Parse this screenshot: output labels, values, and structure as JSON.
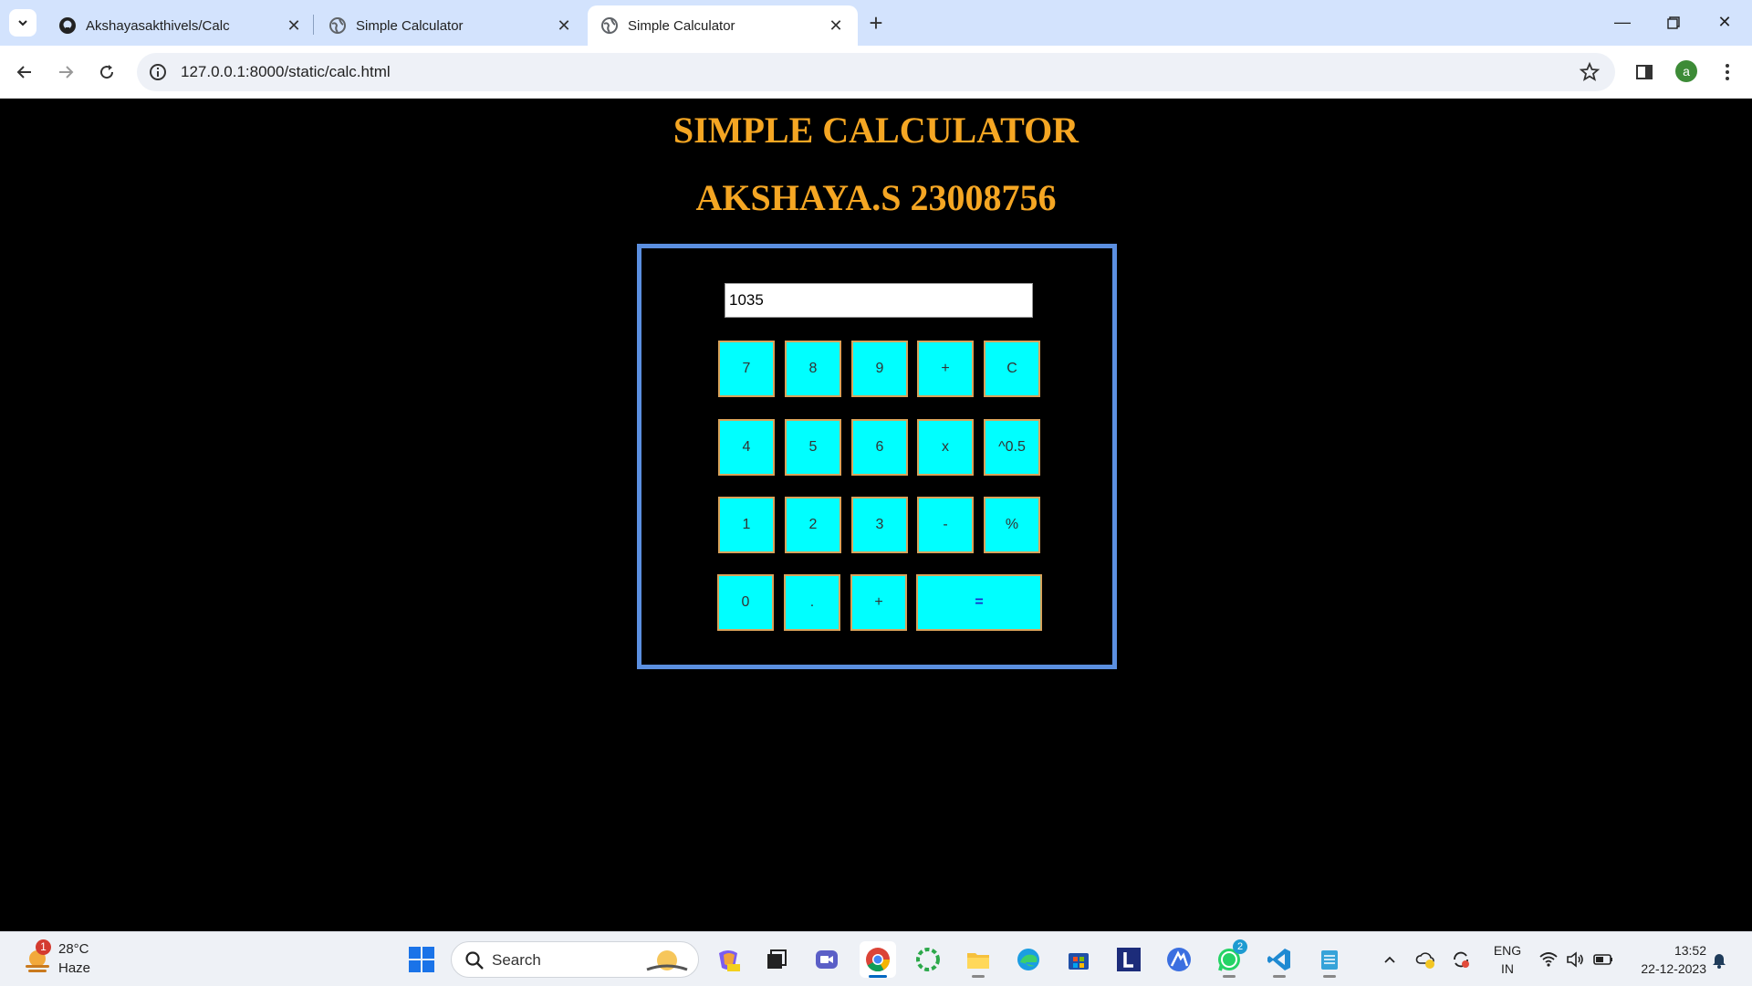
{
  "browser": {
    "tabs": [
      {
        "title": "Akshayasakthivels/Calc",
        "icon": "github-icon",
        "active": false
      },
      {
        "title": "Simple Calculator",
        "icon": "globe-icon",
        "active": false
      },
      {
        "title": "Simple Calculator",
        "icon": "globe-icon",
        "active": true
      }
    ],
    "new_tab_label": "+",
    "url": "127.0.0.1:8000/static/calc.html",
    "profile_initial": "a"
  },
  "page": {
    "heading": "SIMPLE CALCULATOR",
    "subheading": "AKSHAYA.S 23008756",
    "display_value": "1035",
    "keys": {
      "row1": [
        "7",
        "8",
        "9",
        "+",
        "C"
      ],
      "row2": [
        "4",
        "5",
        "6",
        "x",
        "^0.5"
      ],
      "row3": [
        "1",
        "2",
        "3",
        "-",
        "%"
      ],
      "row4": [
        "0",
        ".",
        "+",
        "="
      ]
    }
  },
  "taskbar": {
    "weather_badge": "1",
    "weather_temp": "28°C",
    "weather_condition": "Haze",
    "search_label": "Search",
    "whatsapp_badge": "2",
    "language_line1": "ENG",
    "language_line2": "IN",
    "time": "13:52",
    "date": "22-12-2023"
  },
  "colors": {
    "heading": "#f5a623",
    "calc_border": "#5b8fe0",
    "key_bg": "#00ffff",
    "key_border": "#d9a25a",
    "equals_text": "#1a2cc9"
  }
}
